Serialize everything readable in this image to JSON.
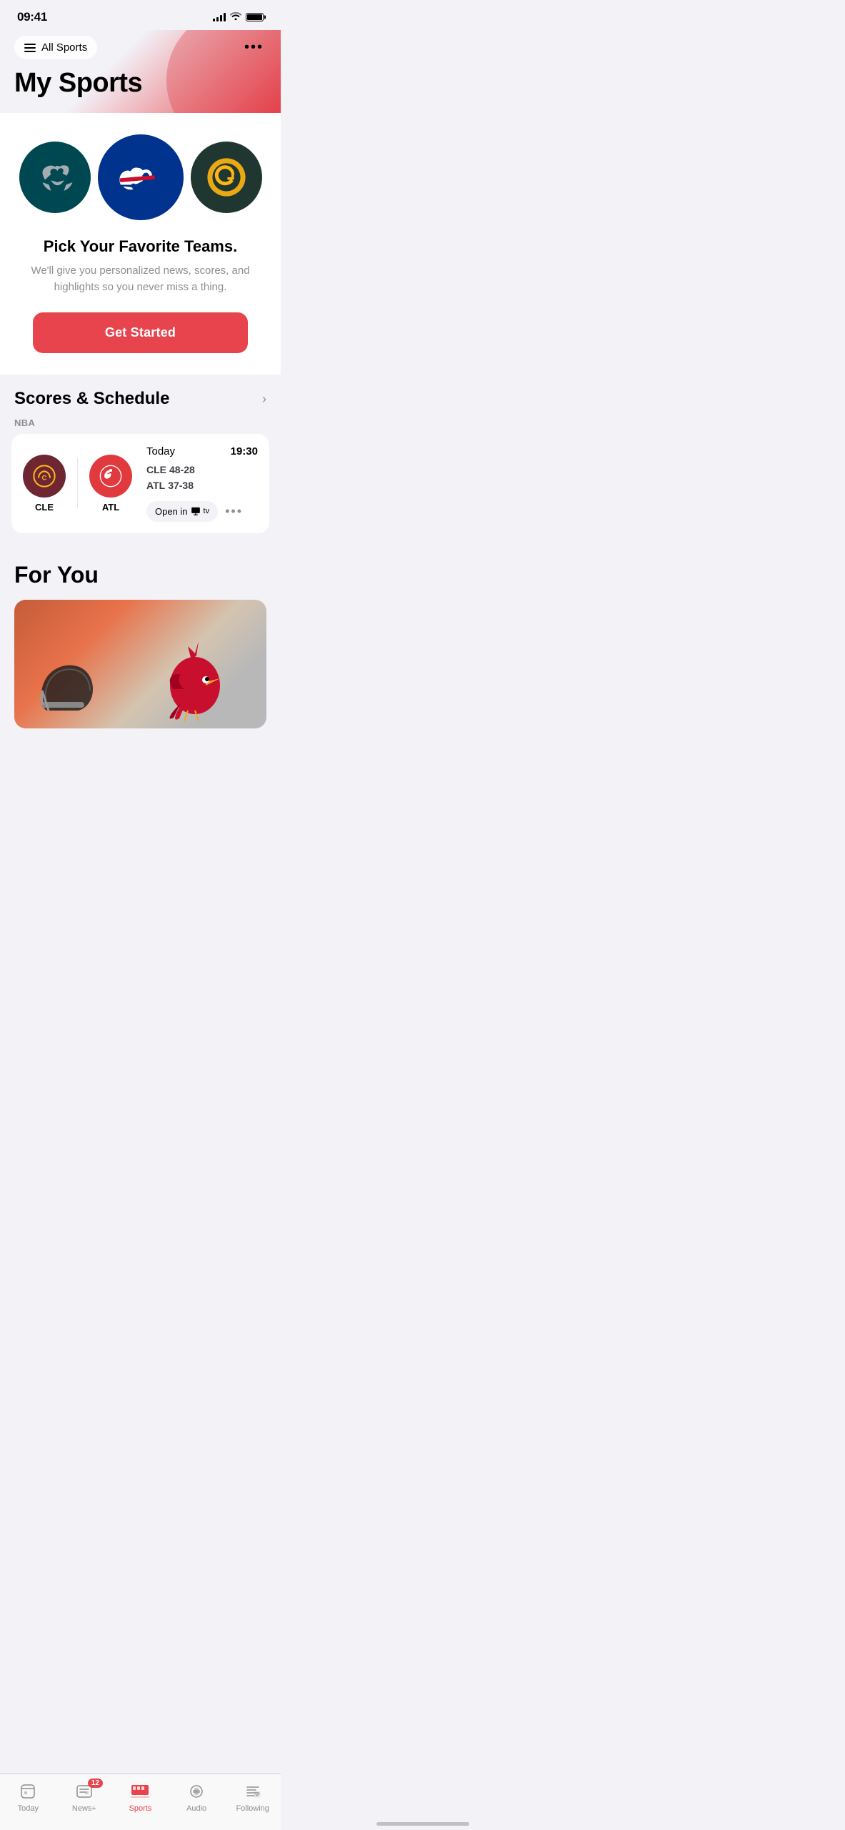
{
  "statusBar": {
    "time": "09:41"
  },
  "header": {
    "allSports": "All Sports",
    "moreIcon": "•••",
    "pageTitle": "My Sports"
  },
  "teamsSection": {
    "teams": [
      {
        "name": "Eagles",
        "abbr": "PHI",
        "color": "#004851"
      },
      {
        "name": "Bills",
        "abbr": "BUF",
        "color": "#00338D"
      },
      {
        "name": "Packers",
        "abbr": "GB",
        "color": "#203731"
      }
    ],
    "pickTitle": "Pick Your Favorite Teams.",
    "pickDesc": "We'll give you personalized news, scores, and highlights so you never miss a thing.",
    "getStartedLabel": "Get Started"
  },
  "scoresSection": {
    "title": "Scores & Schedule",
    "league": "NBA",
    "game": {
      "date": "Today",
      "time": "19:30",
      "team1Abbr": "CLE",
      "team1Record": "48-28",
      "team2Abbr": "ATL",
      "team2Record": "37-38",
      "openInTv": "Open in",
      "moreOptions": "•••"
    }
  },
  "forYouSection": {
    "title": "For You"
  },
  "tabBar": {
    "tabs": [
      {
        "label": "Today",
        "icon": "today-icon",
        "active": false
      },
      {
        "label": "News+",
        "icon": "newsplus-icon",
        "active": false,
        "badge": "12"
      },
      {
        "label": "Sports",
        "icon": "sports-icon",
        "active": true
      },
      {
        "label": "Audio",
        "icon": "audio-icon",
        "active": false
      },
      {
        "label": "Following",
        "icon": "following-icon",
        "active": false
      }
    ]
  }
}
